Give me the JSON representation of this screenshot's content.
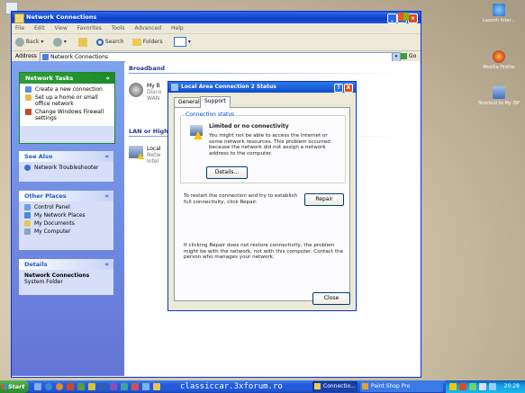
{
  "desktop": {
    "icons": [
      {
        "label": "Launch Inter..."
      },
      {
        "label": "Mozilla Firefox"
      },
      {
        "label": "Shortcut to My ISP"
      }
    ]
  },
  "explorer": {
    "title": "Network Connections",
    "menu": [
      "File",
      "Edit",
      "View",
      "Favorites",
      "Tools",
      "Advanced",
      "Help"
    ],
    "toolbar": {
      "back": "Back",
      "search": "Search",
      "folders": "Folders"
    },
    "address": {
      "label": "Address",
      "value": "Network Connections",
      "go": "Go"
    },
    "tasks": {
      "network_tasks": {
        "title": "Network Tasks",
        "items": [
          "Create a new connection",
          "Set up a home or small office network",
          "Change Windows Firewall settings"
        ]
      },
      "see_also": {
        "title": "See Also",
        "items": [
          "Network Troubleshooter"
        ]
      },
      "other_places": {
        "title": "Other Places",
        "items": [
          "Control Panel",
          "My Network Places",
          "My Documents",
          "My Computer"
        ]
      },
      "details": {
        "title": "Details",
        "name": "Network Connections",
        "type": "System Folder"
      }
    },
    "sections": {
      "broadband": "Broadband",
      "lan": "LAN or High-Sp"
    },
    "items": [
      {
        "name": "My B",
        "sub1": "Disco",
        "sub2": "WAN"
      },
      {
        "name": "Local",
        "sub1": "Netw",
        "sub2": "Intel"
      }
    ]
  },
  "dialog": {
    "title": "Local Area Connection 2 Status",
    "help": "?",
    "close_x": "X",
    "tabs": [
      "General",
      "Support"
    ],
    "active_tab": "Support",
    "group_label": "Connection status",
    "status_title": "Limited or no connectivity",
    "status_text": "You might not be able to access the Internet or some network resources. This problem occurred because the network did not assign a network address to the computer.",
    "details_button": "Details...",
    "repair_text": "To restart the connection and try to establish full connectivity, click Repair.",
    "repair_button": "Repair",
    "note": "If clicking Repair does not restore connectivity, the problem might be with the network, not with this computer. Contact the person who manages your network.",
    "close_button": "Close"
  },
  "taskbar": {
    "start": "Start",
    "tasks": [
      {
        "label": "Connectio..."
      },
      {
        "label": "Paint Shop Pro"
      }
    ],
    "watermark": "classiccar.3xforum.ro",
    "clock": "20:28"
  },
  "colors": {
    "xp_blue": "#0a3fc6",
    "start_green": "#3a9a3a",
    "warning_yellow": "#f4c800",
    "link_blue": "#215dc6"
  }
}
